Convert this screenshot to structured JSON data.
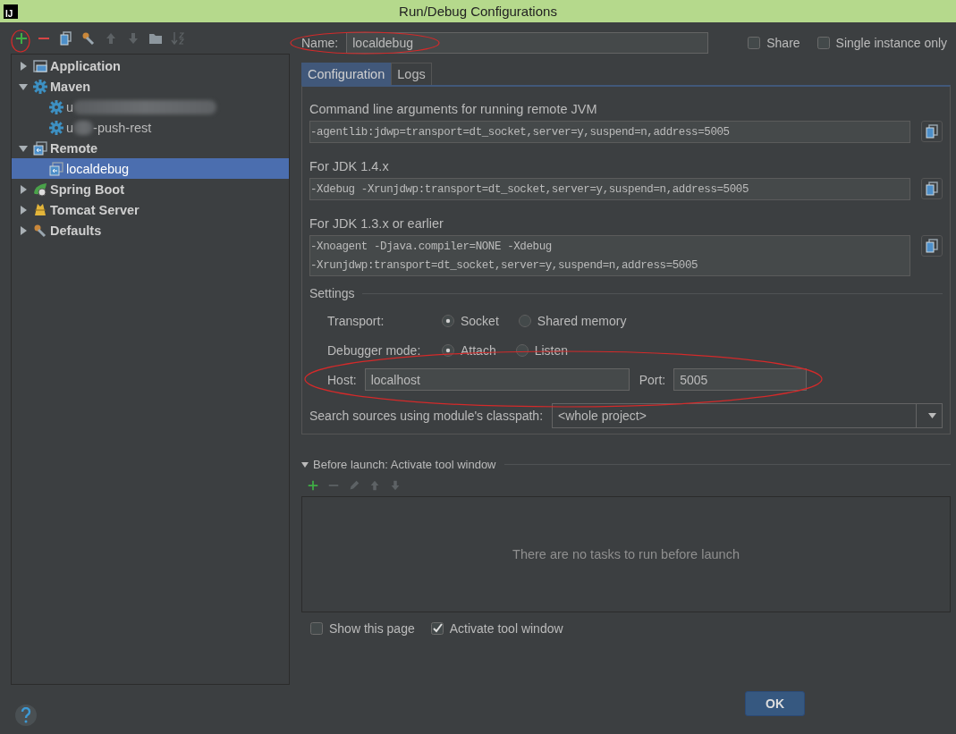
{
  "window": {
    "title": "Run/Debug Configurations",
    "logo": "IJ"
  },
  "toolbar": [
    {
      "kind": "add",
      "disabled": false
    },
    {
      "kind": "remove",
      "disabled": false
    },
    {
      "kind": "copy",
      "disabled": false
    },
    {
      "kind": "wrench",
      "disabled": false
    },
    {
      "kind": "up",
      "disabled": true
    },
    {
      "kind": "down",
      "disabled": true
    },
    {
      "kind": "folder",
      "disabled": false
    },
    {
      "kind": "sort",
      "disabled": true
    }
  ],
  "tree": [
    {
      "label": "Application",
      "kind": "application",
      "expanded": false,
      "selected": false
    },
    {
      "label": "Maven",
      "kind": "maven",
      "expanded": true,
      "selected": false,
      "children": [
        {
          "label": "u",
          "redacted": true,
          "kind": "maven",
          "selected": false
        },
        {
          "label": "u",
          "label_end": "-push-rest",
          "redacted": true,
          "kind": "maven",
          "selected": false
        }
      ]
    },
    {
      "label": "Remote",
      "kind": "remote",
      "expanded": true,
      "selected": false,
      "children": [
        {
          "label": "localdebug",
          "kind": "remote",
          "selected": true
        }
      ]
    },
    {
      "label": "Spring Boot",
      "kind": "spring",
      "expanded": false,
      "selected": false
    },
    {
      "label": "Tomcat Server",
      "kind": "tomcat",
      "expanded": false,
      "selected": false
    },
    {
      "label": "Defaults",
      "kind": "wrench",
      "expanded": false,
      "selected": false
    }
  ],
  "name_field": {
    "label": "Name:",
    "value": "localdebug"
  },
  "share": {
    "label": "Share",
    "checked": false
  },
  "single_instance": {
    "label": "Single instance only",
    "checked": false
  },
  "tabs": [
    {
      "label": "Configuration",
      "selected": true
    },
    {
      "label": "Logs",
      "selected": false
    }
  ],
  "arguments": [
    {
      "label": "Command line arguments for running remote JVM",
      "lines": [
        "-agentlib:jdwp=transport=dt_socket,server=y,suspend=n,address=5005"
      ]
    },
    {
      "label": "For JDK 1.4.x",
      "lines": [
        "-Xdebug -Xrunjdwp:transport=dt_socket,server=y,suspend=n,address=5005"
      ]
    },
    {
      "label": "For JDK 1.3.x or earlier",
      "lines": [
        "-Xnoagent -Djava.compiler=NONE -Xdebug",
        "-Xrunjdwp:transport=dt_socket,server=y,suspend=n,address=5005"
      ]
    }
  ],
  "settings": {
    "title": "Settings",
    "transport": {
      "label": "Transport:",
      "options": [
        {
          "label": "Socket",
          "selected": true
        },
        {
          "label": "Shared memory",
          "selected": false
        }
      ]
    },
    "debugger_mode": {
      "label": "Debugger mode:",
      "options": [
        {
          "label": "Attach",
          "selected": true
        },
        {
          "label": "Listen",
          "selected": false
        }
      ]
    },
    "host": {
      "label": "Host:",
      "value": "localhost"
    },
    "port": {
      "label": "Port:",
      "value": "5005"
    }
  },
  "search_sources": {
    "label": "Search sources using module's classpath:",
    "value": "<whole project>"
  },
  "before_launch": {
    "title": "Before launch: Activate tool window",
    "expanded": true,
    "toolbar": [
      {
        "kind": "add",
        "disabled": false
      },
      {
        "kind": "remove",
        "disabled": true
      },
      {
        "kind": "edit",
        "disabled": true
      },
      {
        "kind": "up",
        "disabled": true
      },
      {
        "kind": "down",
        "disabled": true
      }
    ],
    "empty_text": "There are no tasks to run before launch"
  },
  "options": [
    {
      "label": "Show this page",
      "checked": false
    },
    {
      "label": "Activate tool window",
      "checked": true
    }
  ],
  "buttons": [
    {
      "label": "OK",
      "default": true
    }
  ]
}
